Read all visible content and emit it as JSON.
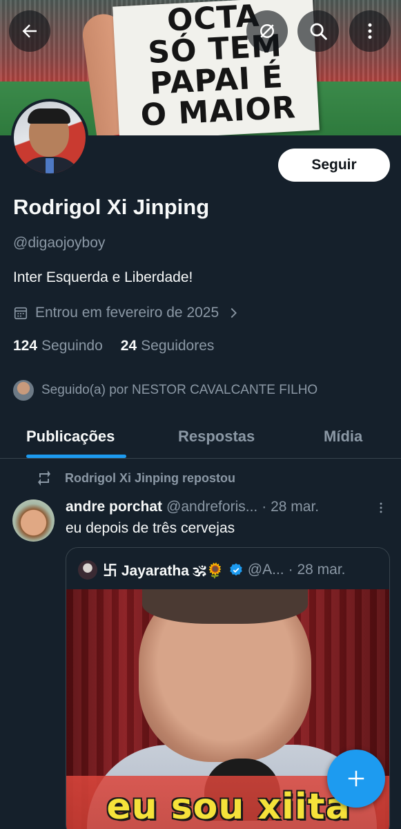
{
  "header": {
    "banner_sign_lines": [
      "OCTA",
      "SÓ TEM",
      "PAPAI É",
      "O MAIOR"
    ],
    "icons": [
      "back-arrow-icon",
      "no-sync-icon",
      "search-icon",
      "more-vertical-icon"
    ]
  },
  "profile": {
    "name": "Rodrigol Xi Jinping",
    "handle": "@digaojoyboy",
    "bio": "Inter Esquerda e Liberdade!",
    "joined": "Entrou em fevereiro de 2025",
    "following_count": "124",
    "following_label": "Seguindo",
    "followers_count": "24",
    "followers_label": "Seguidores",
    "followed_by": "Seguido(a) por NESTOR CAVALCANTE FILHO",
    "follow_button": "Seguir"
  },
  "tabs": [
    {
      "label": "Publicações",
      "active": true
    },
    {
      "label": "Respostas",
      "active": false
    },
    {
      "label": "Mídia",
      "active": false
    }
  ],
  "timeline": {
    "repost_label": "Rodrigol Xi Jinping repostou",
    "post": {
      "author": "andre porchat",
      "handle": "@andreforis...",
      "date": "· 28 mar.",
      "text": "eu depois de três cervejas",
      "quote": {
        "author": "卐 Jayaratha 🕉🌻",
        "handle": "@A...",
        "date": "· 28 mar.",
        "media_caption": "eu sou xiita"
      }
    }
  },
  "colors": {
    "background": "#15202b",
    "accent": "#1d9bf0",
    "text_primary": "#f7f9f9",
    "text_secondary": "#8b98a5",
    "border": "#38444d"
  },
  "fab": {
    "icon": "plus-icon"
  }
}
